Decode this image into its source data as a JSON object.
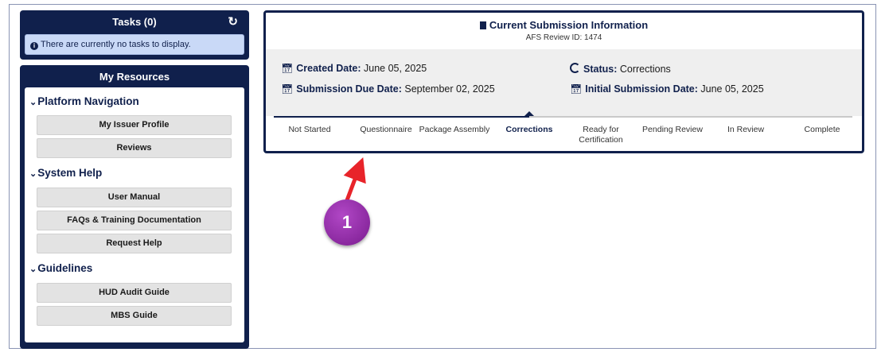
{
  "tasks": {
    "title": "Tasks (0)",
    "message": "There are currently no tasks to display."
  },
  "resources": {
    "title": "My Resources",
    "sections": [
      {
        "title": "Platform Navigation",
        "items": [
          "My Issuer Profile",
          "Reviews"
        ]
      },
      {
        "title": "System Help",
        "items": [
          "User Manual",
          "FAQs & Training Documentation",
          "Request Help"
        ]
      },
      {
        "title": "Guidelines",
        "items": [
          "HUD Audit Guide",
          "MBS Guide"
        ]
      }
    ]
  },
  "submission": {
    "title": "Current Submission Information",
    "review_id": "AFS Review ID: 1474",
    "created_label": "Created Date:",
    "created_value": "June 05, 2025",
    "due_label": "Submission Due Date:",
    "due_value": "September 02, 2025",
    "status_label": "Status:",
    "status_value": "Corrections",
    "initial_label": "Initial Submission Date:",
    "initial_value": "June 05, 2025"
  },
  "progress": {
    "steps": [
      "Not Started",
      "Questionnaire",
      "Package Assembly",
      "Corrections",
      "Ready for Certification",
      "Pending Review",
      "In Review",
      "Complete"
    ],
    "current_index": 3
  },
  "annotation": {
    "number": "1"
  },
  "colors": {
    "navy": "#10204c",
    "band": "#efefef",
    "badge": "#9b2fb2",
    "arrow": "#e8242a"
  }
}
